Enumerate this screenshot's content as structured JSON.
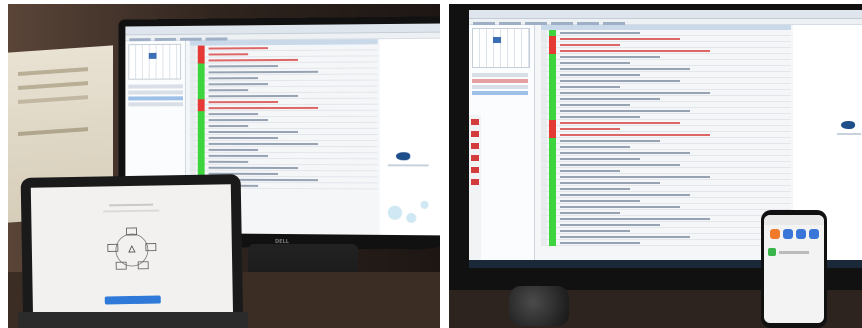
{
  "scene": {
    "left_photo": {
      "monitor_brand": "DELL",
      "tablet_screen": {
        "title": "",
        "subtitle": "",
        "button_label": ""
      }
    },
    "right_photo": {
      "phone_screen": {
        "header": ""
      }
    }
  },
  "palette": {
    "status_green": "#3ed43e",
    "status_red": "#e53935",
    "selection_blue": "#3b6fb6",
    "tablet_button": "#2f7ad8",
    "phone_icon_orange": "#f07a2a",
    "phone_icon_blue": "#3a76d8"
  },
  "grid_left": [
    "red",
    "red",
    "red",
    "green",
    "green",
    "green",
    "green",
    "green",
    "green",
    "red",
    "red",
    "green",
    "green",
    "green",
    "green",
    "green",
    "green",
    "green",
    "green",
    "green",
    "green",
    "green",
    "green",
    "green"
  ],
  "grid_right": [
    "green",
    "red",
    "red",
    "red",
    "green",
    "green",
    "green",
    "green",
    "green",
    "green",
    "green",
    "green",
    "green",
    "green",
    "green",
    "red",
    "red",
    "red",
    "green",
    "green",
    "green",
    "green",
    "green",
    "green",
    "green",
    "green",
    "green",
    "green",
    "green",
    "green",
    "green",
    "green",
    "green",
    "green",
    "green",
    "green"
  ]
}
